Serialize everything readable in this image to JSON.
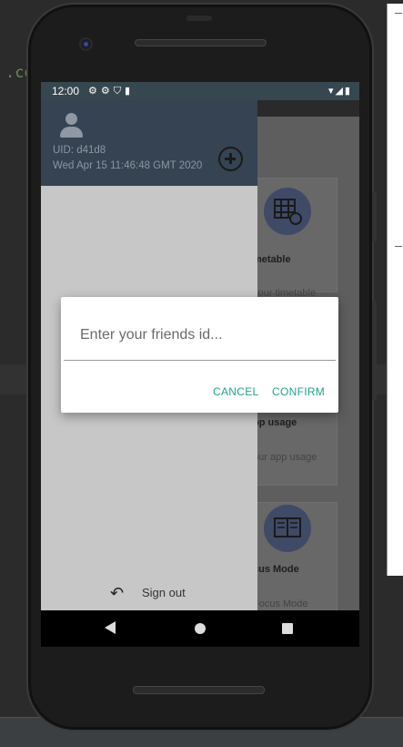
{
  "ide": {
    "code_fragment": ".co"
  },
  "status_bar": {
    "time": "12:00",
    "left_icons": "⚙⚙⛉▮",
    "right_icons": "▾◢▮"
  },
  "app_cards": [
    {
      "title": "metable",
      "subtitle": "your timetable",
      "icon": "timetable-icon"
    },
    {
      "title": "pp usage",
      "subtitle": "our app usage",
      "icon": "app-usage-icon"
    },
    {
      "title": "cus Mode",
      "subtitle": "Focus Mode",
      "icon": "book-icon"
    }
  ],
  "drawer": {
    "uid": "UID: d41d8",
    "date": "Wed Apr 15 11:46:48 GMT 2020",
    "sign_out": "Sign out",
    "sign_out_icon": "↶"
  },
  "dialog": {
    "placeholder": "Enter your friends id...",
    "value": "",
    "cancel": "CANCEL",
    "confirm": "CONFIRM",
    "accent_color": "#1ba58a"
  },
  "colors": {
    "drawer_header": "#354352",
    "status_bar": "#37474f"
  }
}
